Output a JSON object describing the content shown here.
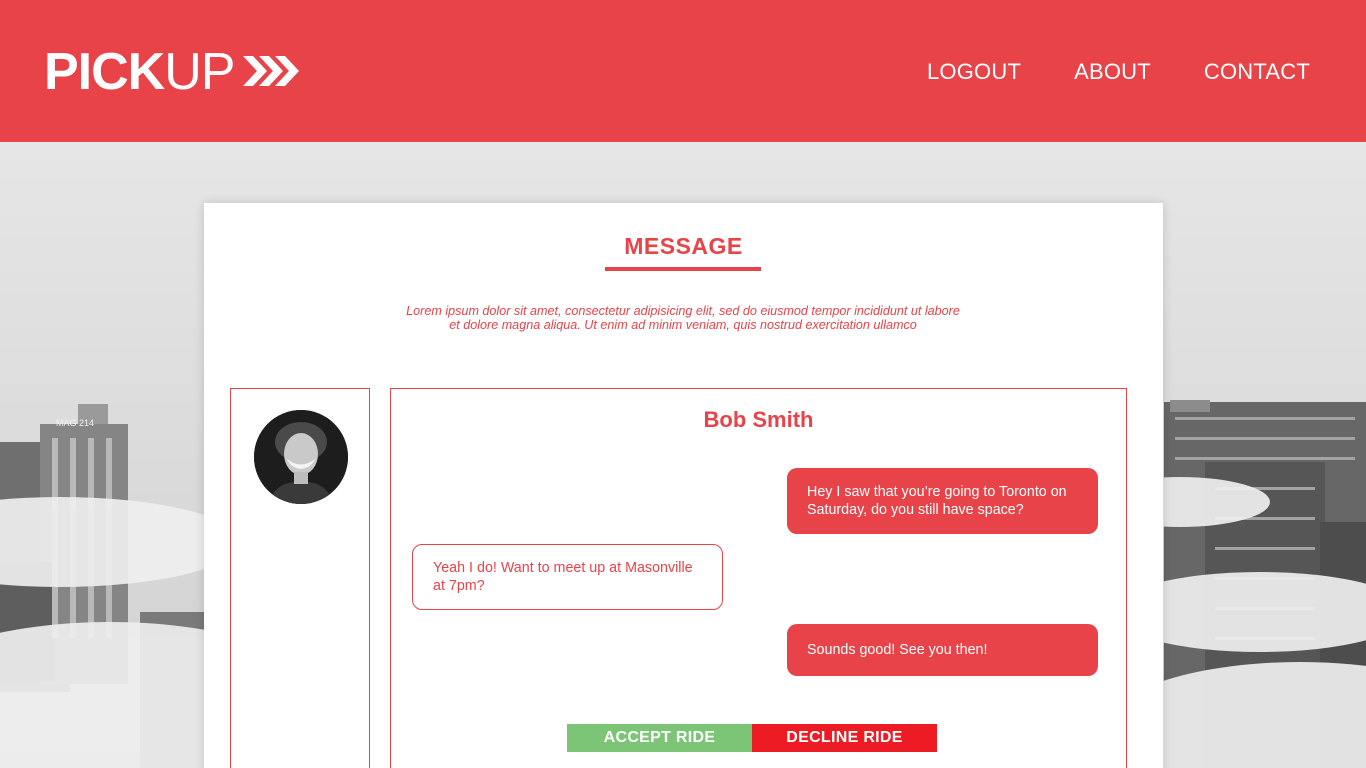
{
  "brand": {
    "logo_bold": "PICK",
    "logo_light": "UP",
    "logo_icon": "triple-chevron-right-icon"
  },
  "nav": {
    "logout": "LOGOUT",
    "about": "ABOUT",
    "contact": "CONTACT"
  },
  "page": {
    "title": "MESSAGE",
    "intro": "Lorem ipsum dolor sit amet, consectetur adipisicing elit, sed do eiusmod tempor incididunt ut labore et dolore magna aliqua. Ut enim ad minim veniam, quis nostrud exercitation ullamco"
  },
  "contact": {
    "name": "Bob Smith",
    "avatar_icon": "user-avatar"
  },
  "messages": [
    {
      "direction": "sent",
      "text": "Hey I saw that you’re going to Toronto on Saturday, do you still have space?"
    },
    {
      "direction": "received",
      "text": "Yeah I do! Want to meet up at Masonville at 7pm?"
    },
    {
      "direction": "sent",
      "text": "Sounds good! See you then!"
    }
  ],
  "actions": {
    "accept_label": "ACCEPT RIDE",
    "decline_label": "DECLINE RIDE"
  },
  "colors": {
    "brand_red": "#e84349",
    "accept_green": "#7cc576",
    "decline_red": "#ed1c24",
    "card_bg": "#ffffff"
  }
}
